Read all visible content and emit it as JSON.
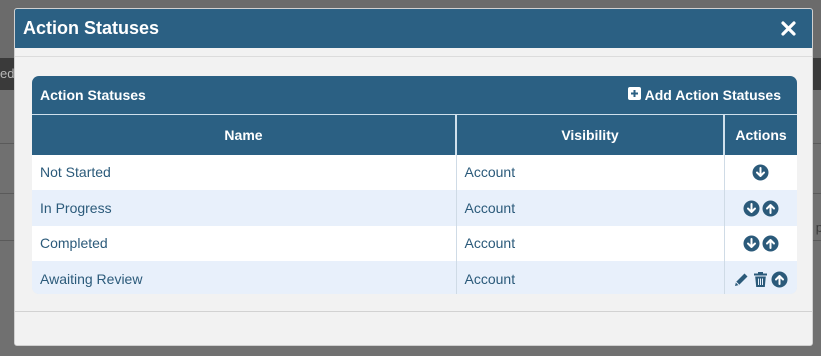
{
  "background": {
    "left_fragment": "ed",
    "right_fragment": "p"
  },
  "modal": {
    "title": "Action Statuses",
    "close_icon": "close-icon"
  },
  "panel": {
    "title": "Action Statuses",
    "add_label": "Add Action Statuses",
    "add_icon": "plus-square-icon"
  },
  "table": {
    "columns": [
      "Name",
      "Visibility",
      "Actions"
    ],
    "rows": [
      {
        "name": "Not Started",
        "visibility": "Account",
        "actions": [
          "move-down-icon"
        ]
      },
      {
        "name": "In Progress",
        "visibility": "Account",
        "actions": [
          "move-down-icon",
          "move-up-icon"
        ]
      },
      {
        "name": "Completed",
        "visibility": "Account",
        "actions": [
          "move-down-icon",
          "move-up-icon"
        ]
      },
      {
        "name": "Awaiting Review",
        "visibility": "Account",
        "actions": [
          "edit-icon",
          "delete-icon",
          "move-up-icon"
        ]
      }
    ]
  },
  "colors": {
    "header": "#2b6083",
    "link_text": "#2b5a7a",
    "row_alt": "#e8f0fb"
  }
}
